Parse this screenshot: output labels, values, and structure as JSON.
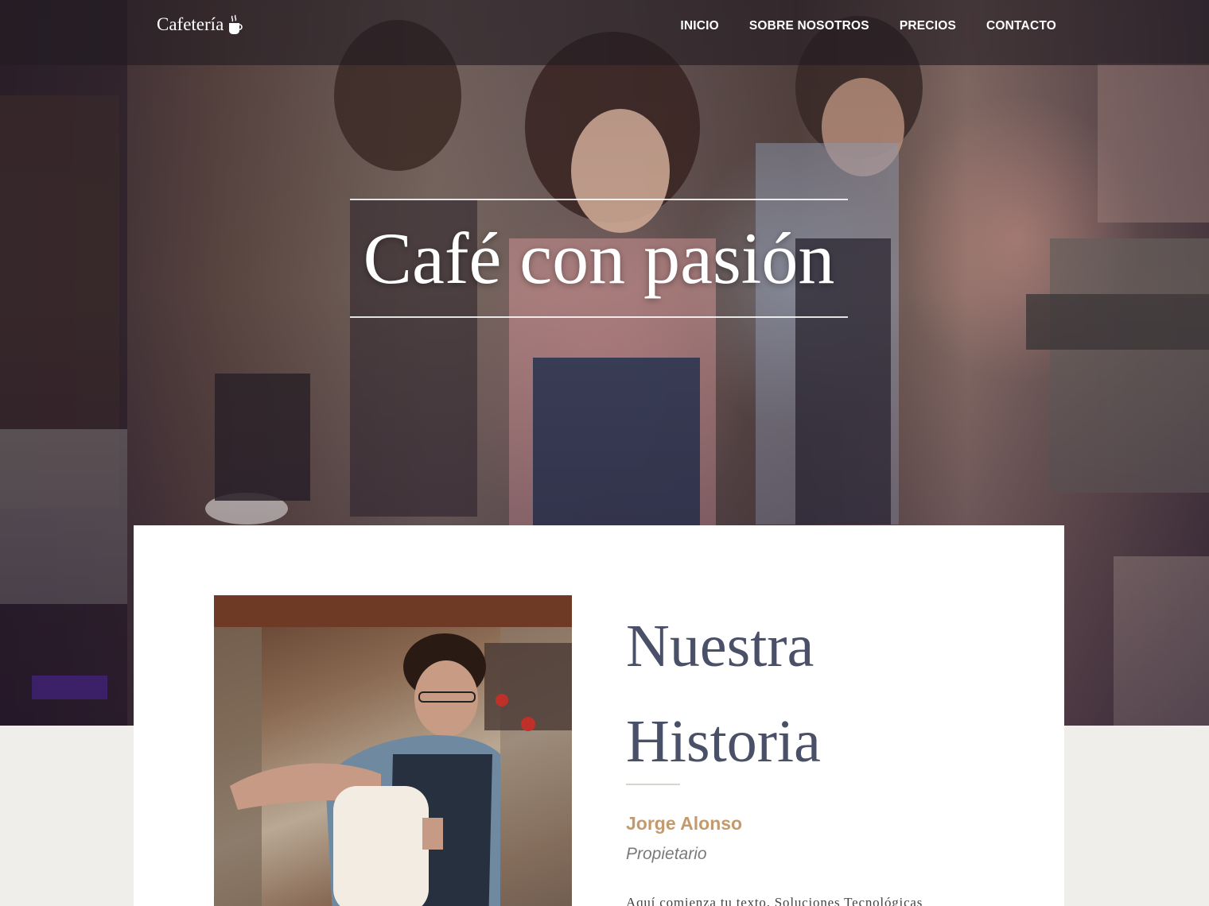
{
  "nav": {
    "brand": "Cafetería",
    "brand_icon": "coffee-cup-icon",
    "links": [
      "INICIO",
      "SOBRE NOSOTROS",
      "PRECIOS",
      "CONTACTO"
    ]
  },
  "hero": {
    "title": "Café con pasión"
  },
  "about": {
    "title": "Nuestra Historia",
    "owner_name": "Jorge Alonso",
    "owner_role": "Propietario",
    "text": "Aquí comienza tu texto. Soluciones Tecnológicas"
  },
  "colors": {
    "accent": "#c49a6c",
    "heading": "#4a5068",
    "page_background": "#efeeea"
  }
}
